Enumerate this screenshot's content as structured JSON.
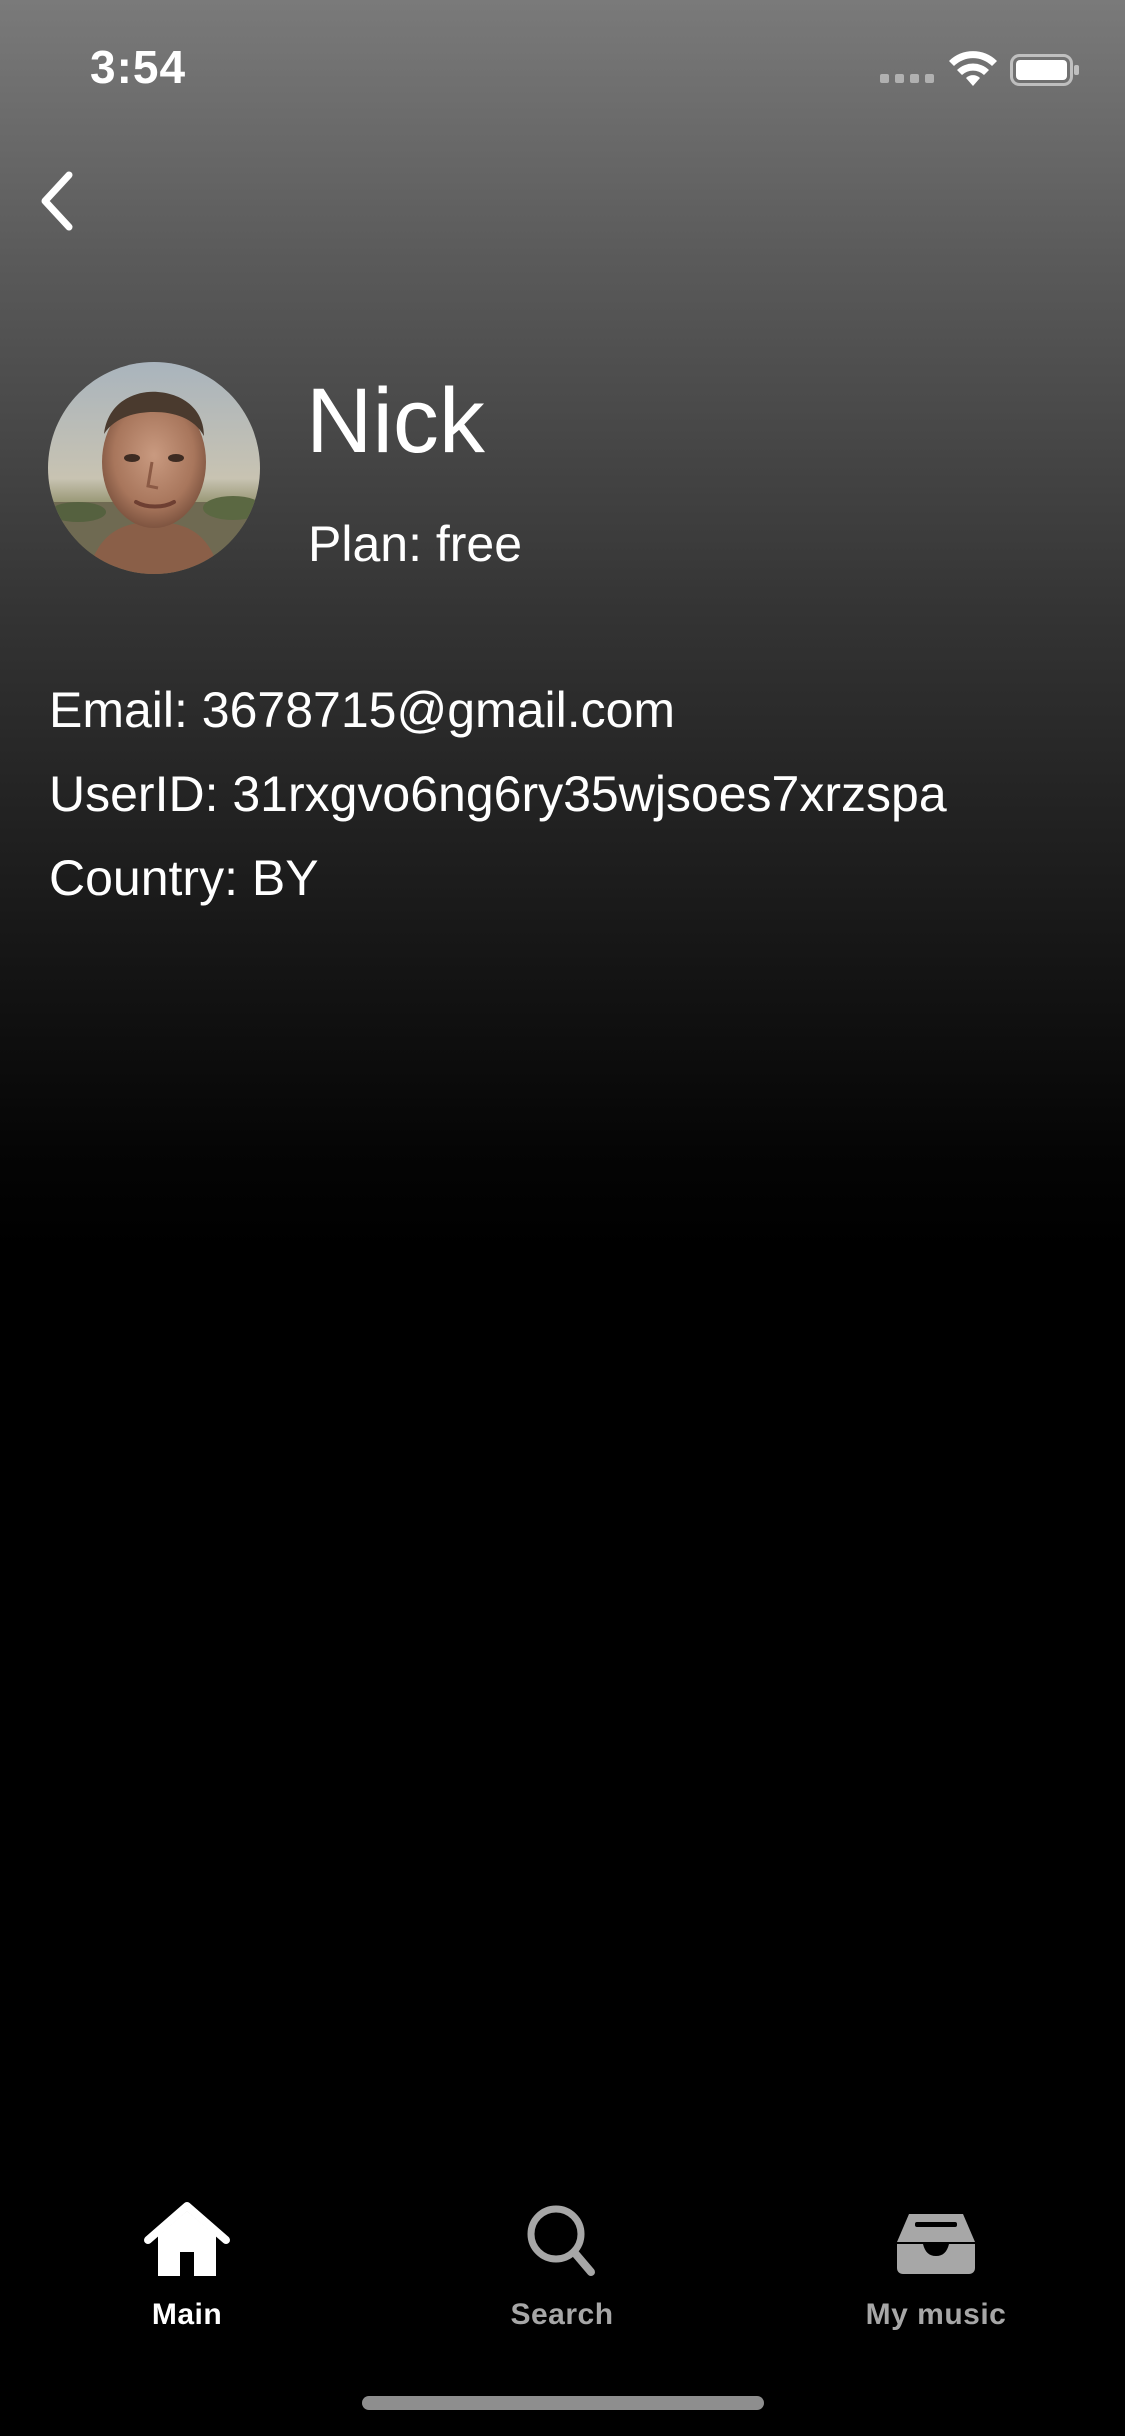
{
  "status_bar": {
    "time": "3:54",
    "icons": [
      "cellular-signal-icon",
      "wifi-icon",
      "battery-icon"
    ]
  },
  "navigation": {
    "back_icon": "chevron-left-icon"
  },
  "profile": {
    "name": "Nick",
    "plan": "Plan: free",
    "avatar_icon": "user-photo"
  },
  "details": {
    "email": "Email: 3678715@gmail.com",
    "user_id": "UserID: 31rxgvo6ng6ry35wjsoes7xrzspa",
    "country": "Country: BY"
  },
  "tab_bar": {
    "tabs": [
      {
        "label": "Main",
        "icon": "home-icon",
        "active": true
      },
      {
        "label": "Search",
        "icon": "search-icon",
        "active": false
      },
      {
        "label": "My music",
        "icon": "library-inbox-icon",
        "active": false
      }
    ]
  },
  "colors": {
    "background_top": "#7a7a7a",
    "background_bottom": "#000000",
    "text_primary": "#ffffff",
    "text_inactive": "#a7a7a7"
  }
}
